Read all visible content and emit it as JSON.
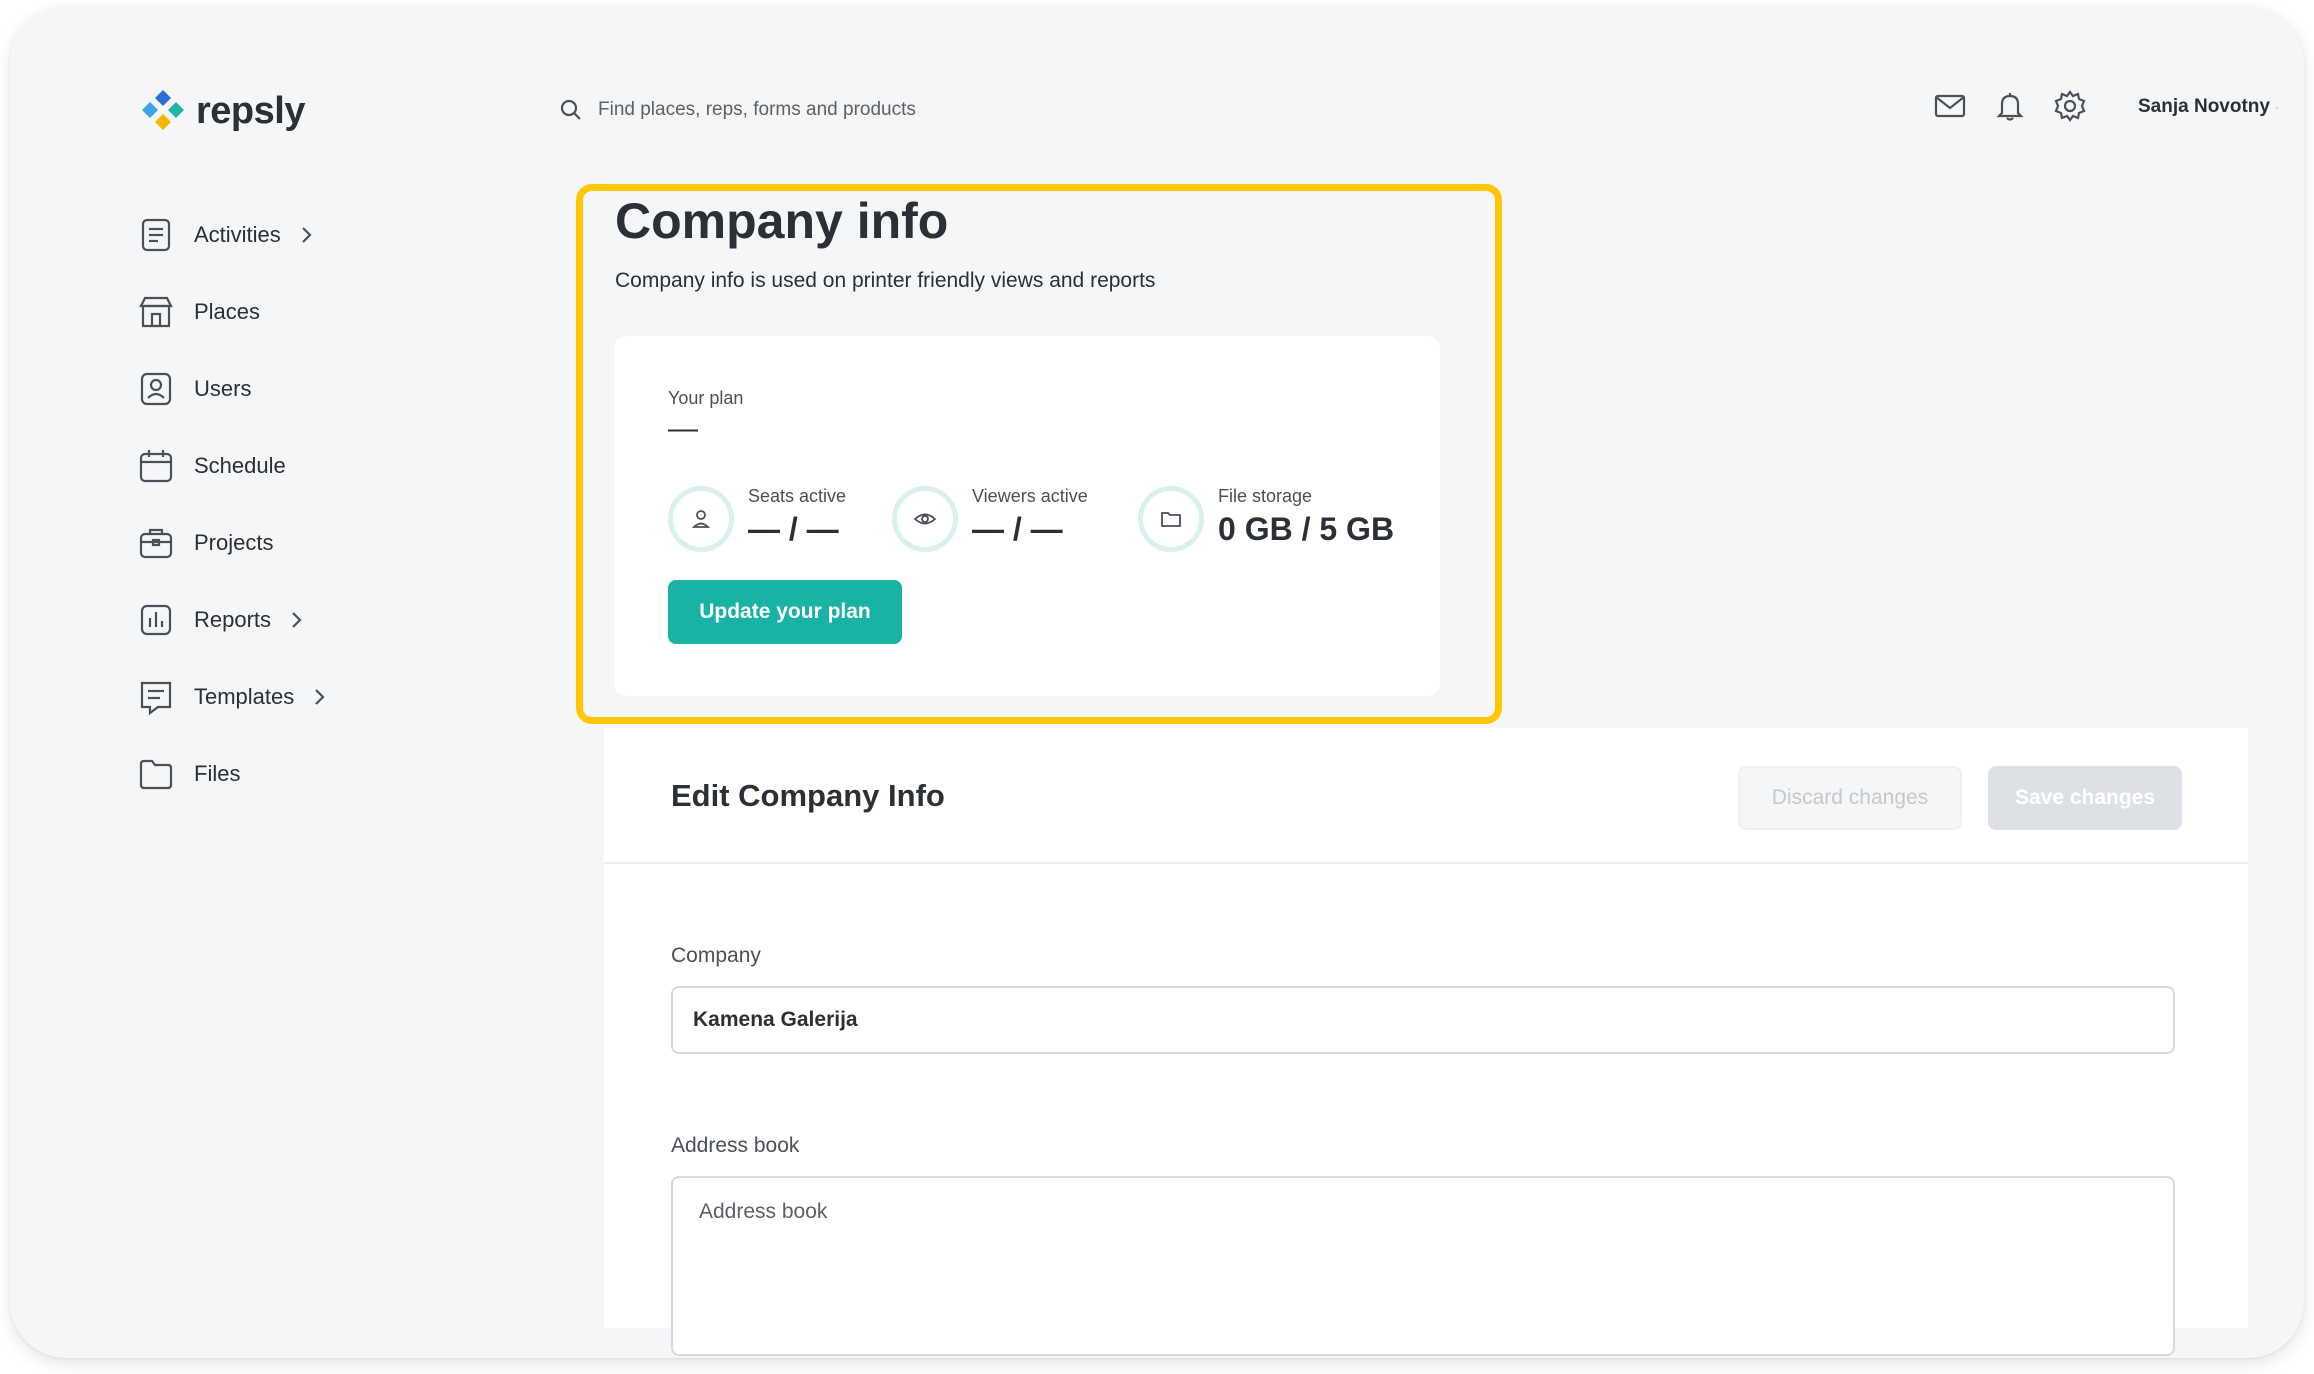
{
  "app": {
    "name": "repsly"
  },
  "sidebar": {
    "items": [
      {
        "label": "Activities",
        "icon": "activities-icon",
        "has_submenu": true
      },
      {
        "label": "Places",
        "icon": "store-icon",
        "has_submenu": false
      },
      {
        "label": "Users",
        "icon": "user-badge-icon",
        "has_submenu": false
      },
      {
        "label": "Schedule",
        "icon": "calendar-icon",
        "has_submenu": false
      },
      {
        "label": "Projects",
        "icon": "briefcase-icon",
        "has_submenu": false
      },
      {
        "label": "Reports",
        "icon": "bar-chart-icon",
        "has_submenu": true
      },
      {
        "label": "Templates",
        "icon": "template-icon",
        "has_submenu": true
      },
      {
        "label": "Files",
        "icon": "folder-icon",
        "has_submenu": false
      }
    ]
  },
  "header": {
    "search_placeholder": "Find places, reps, forms and products",
    "icons": [
      "mail-icon",
      "bell-icon",
      "gear-icon"
    ],
    "user_name": "Sanja Novotny"
  },
  "page": {
    "title": "Company info",
    "subtitle": "Company info is used on printer friendly views and reports"
  },
  "plan": {
    "label": "Your plan",
    "value": "—",
    "stats": [
      {
        "label": "Seats active",
        "value": "— / —",
        "icon": "person-icon"
      },
      {
        "label": "Viewers active",
        "value": "— / —",
        "icon": "eye-icon"
      },
      {
        "label": "File storage",
        "value": "0 GB / 5 GB",
        "icon": "folder-icon"
      }
    ],
    "update_button": "Update your plan"
  },
  "edit": {
    "title": "Edit Company Info",
    "discard_button": "Discard changes",
    "save_button": "Save changes",
    "company_label": "Company",
    "company_value": "Kamena Galerija",
    "address_label": "Address book",
    "address_placeholder": "Address book"
  },
  "colors": {
    "accent": "#18b3a4",
    "highlight": "#ffc700",
    "background": "#f5f6f8",
    "text": "#2b2f36"
  }
}
